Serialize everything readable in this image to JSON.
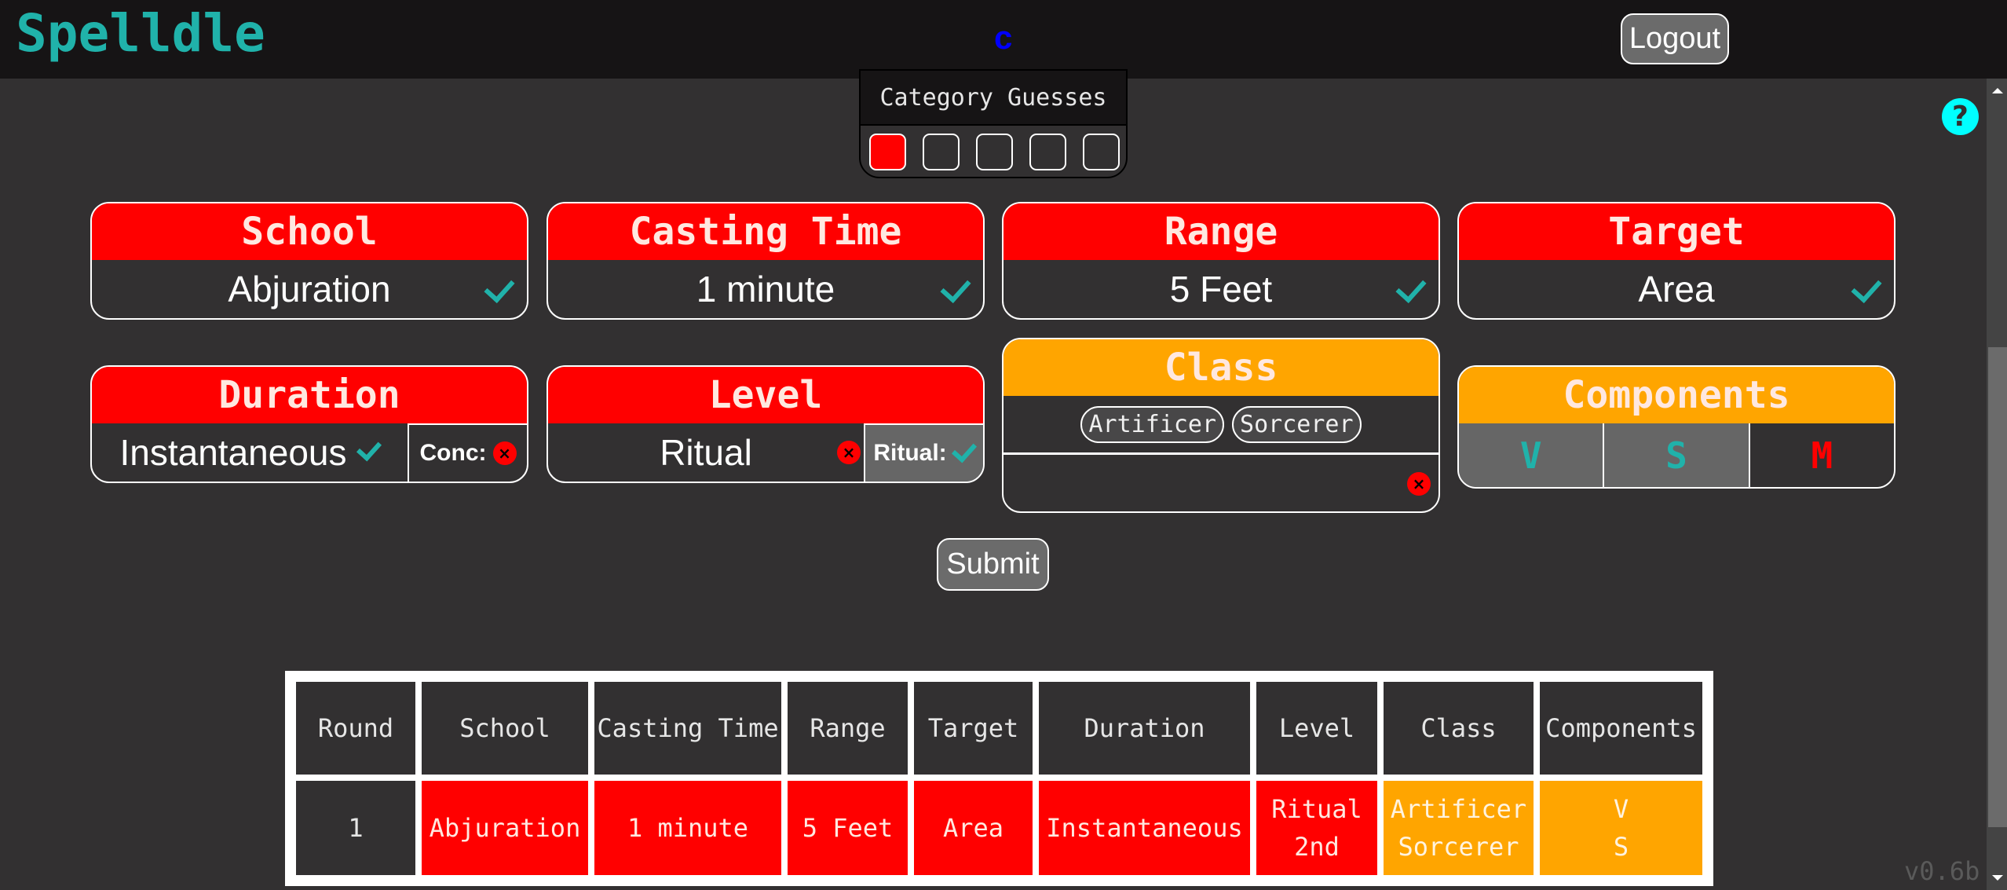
{
  "header": {
    "logo": "Spelldle",
    "user_initial": "c",
    "logout_label": "Logout"
  },
  "help_icon": "?",
  "category_guesses": {
    "title": "Category Guesses",
    "total": 5,
    "used": 1,
    "used_color": "#ff0000"
  },
  "cards": {
    "school": {
      "title": "School",
      "value": "Abjuration",
      "status": "incorrect",
      "confirmed": true
    },
    "casting_time": {
      "title": "Casting Time",
      "value": "1 minute",
      "status": "incorrect",
      "confirmed": true
    },
    "range": {
      "title": "Range",
      "value": "5 Feet",
      "status": "incorrect",
      "confirmed": true
    },
    "target": {
      "title": "Target",
      "value": "Area",
      "status": "incorrect",
      "confirmed": true
    },
    "duration": {
      "title": "Duration",
      "value": "Instantaneous",
      "status": "incorrect",
      "confirmed": true,
      "conc_label": "Conc:",
      "conc_value": false
    },
    "level": {
      "title": "Level",
      "value": "Ritual",
      "status": "incorrect",
      "confirmed": false,
      "ritual_label": "Ritual:",
      "ritual_value": true
    },
    "class": {
      "title": "Class",
      "status": "partial",
      "tags": [
        "Artificer",
        "Sorcerer"
      ],
      "input_value": "",
      "confirmed": false
    },
    "components": {
      "title": "Components",
      "status": "partial",
      "items": [
        {
          "label": "V",
          "selected": true
        },
        {
          "label": "S",
          "selected": true
        },
        {
          "label": "M",
          "selected": false
        }
      ]
    }
  },
  "submit_label": "Submit",
  "history": {
    "columns": [
      "Round",
      "School",
      "Casting Time",
      "Range",
      "Target",
      "Duration",
      "Level",
      "Class",
      "Components"
    ],
    "rows": [
      {
        "round": "1",
        "cells": [
          {
            "lines": [
              "Abjuration"
            ],
            "status": "incorrect"
          },
          {
            "lines": [
              "1 minute"
            ],
            "status": "incorrect"
          },
          {
            "lines": [
              "5 Feet"
            ],
            "status": "incorrect"
          },
          {
            "lines": [
              "Area"
            ],
            "status": "incorrect"
          },
          {
            "lines": [
              "Instantaneous"
            ],
            "status": "incorrect"
          },
          {
            "lines": [
              "Ritual",
              "2nd"
            ],
            "status": "incorrect"
          },
          {
            "lines": [
              "Artificer",
              "Sorcerer"
            ],
            "status": "partial"
          },
          {
            "lines": [
              "V",
              "S"
            ],
            "status": "partial"
          }
        ]
      }
    ]
  },
  "colors": {
    "incorrect": "#ff0000",
    "partial": "#ffa500",
    "correct_check": "#20b2aa",
    "brand": "#20b2aa"
  },
  "version": "v0.6b"
}
